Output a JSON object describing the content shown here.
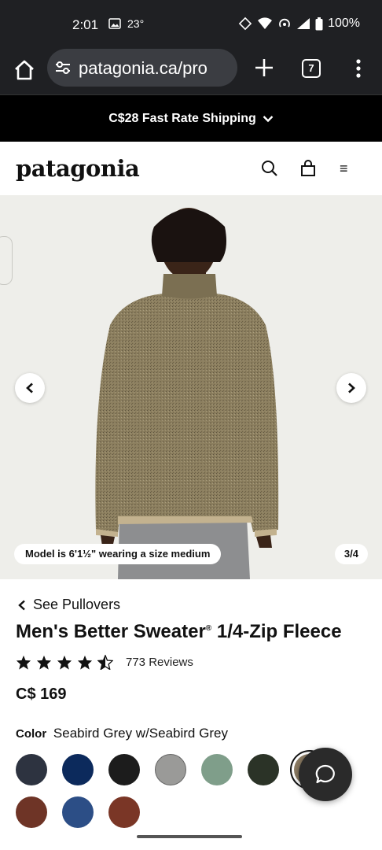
{
  "status_bar": {
    "time": "2:01",
    "temperature": "23°",
    "battery": "100%",
    "icons": [
      "image-icon",
      "rotate-icon",
      "wifi-icon",
      "hotspot-icon",
      "signal-icon",
      "battery-icon"
    ]
  },
  "browser": {
    "url": "patagonia.ca/pro",
    "tab_count": "7"
  },
  "promo": {
    "text": "C$28 Fast Rate Shipping"
  },
  "site": {
    "logo": "patagonia",
    "menu_glyph": "≡"
  },
  "gallery": {
    "model_note": "Model is 6'1½\" wearing a size medium",
    "counter": "3/4"
  },
  "product": {
    "back_link": "See Pullovers",
    "title": "Men's Better Sweater",
    "title_mark": "®",
    "title_suffix": " 1/4-Zip Fleece",
    "rating": 4.5,
    "reviews": "773 Reviews",
    "price": "C$ 169",
    "color_label": "Color",
    "color_value": "Seabird Grey w/Seabird Grey"
  },
  "swatch_colors": [
    "#2d3340",
    "#0c2a5c",
    "#1c1c1c",
    "#9a9a98",
    "#7f9e8a",
    "#2b3327",
    "#8a7a62",
    "#6e3426",
    "#2c4e86",
    "#7a3626"
  ]
}
